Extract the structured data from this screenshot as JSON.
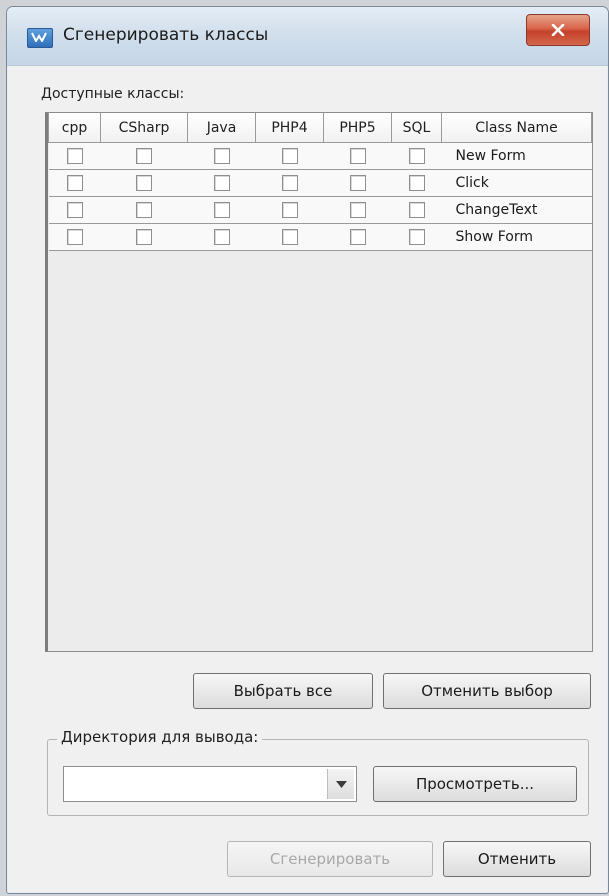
{
  "window": {
    "title": "Сгенерировать классы"
  },
  "classes": {
    "label": "Доступные классы:",
    "columns": [
      "cpp",
      "CSharp",
      "Java",
      "PHP4",
      "PHP5",
      "SQL",
      "Class Name"
    ],
    "rows": [
      {
        "name": "New Form",
        "checks": [
          false,
          false,
          false,
          false,
          false,
          false
        ]
      },
      {
        "name": "Click",
        "checks": [
          false,
          false,
          false,
          false,
          false,
          false
        ]
      },
      {
        "name": "ChangeText",
        "checks": [
          false,
          false,
          false,
          false,
          false,
          false
        ]
      },
      {
        "name": "Show Form",
        "checks": [
          false,
          false,
          false,
          false,
          false,
          false
        ]
      }
    ]
  },
  "selection": {
    "select_all": "Выбрать все",
    "deselect": "Отменить выбор"
  },
  "output": {
    "group_label": "Директория для вывода:",
    "directory_value": "",
    "browse": "Просмотреть..."
  },
  "footer": {
    "generate": "Сгенерировать",
    "cancel": "Отменить"
  }
}
